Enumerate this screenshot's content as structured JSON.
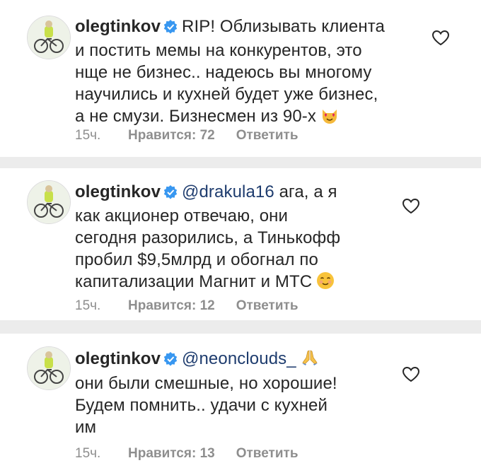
{
  "comments": [
    {
      "username": "olegtinkov",
      "lines": [
        "RIP! Облизывать клиента",
        "и постить мемы на конкурентов, это",
        "нще не бизнес.. надеюсь вы  многому",
        "научились и кухней будет уже бизнес,",
        "а не смузи. Бизнесмен из 90-х"
      ],
      "time": "15ч.",
      "likes": "Нравится: 72",
      "reply": "Ответить",
      "emoji": "heart-eyes-cat-icon"
    },
    {
      "username": "olegtinkov",
      "mention": "@drakula16",
      "first_text": "ага, а я",
      "lines": [
        "как акционер отвечаю, они",
        "сегодня разорились, а Тинькофф",
        "пробил $9,5млрд и обогнал по",
        "капитализации Магнит и МТС"
      ],
      "time": "15ч.",
      "likes": "Нравится: 12",
      "reply": "Ответить",
      "emoji": "smiling-face-icon"
    },
    {
      "username": "olegtinkov",
      "mention": "@neonclouds_",
      "lines": [
        "они были смешные, но хорошие!",
        "Будем помнить.. удачи с кухней",
        "им"
      ],
      "time": "15ч.",
      "likes": "Нравится: 13",
      "reply": "Ответить",
      "emoji": "folded-hands-icon"
    }
  ],
  "colors": {
    "text": "#262626",
    "muted": "#8e8e8e",
    "mention": "#1e3c6e",
    "verified": "#3897f0",
    "separator": "#ececec"
  }
}
